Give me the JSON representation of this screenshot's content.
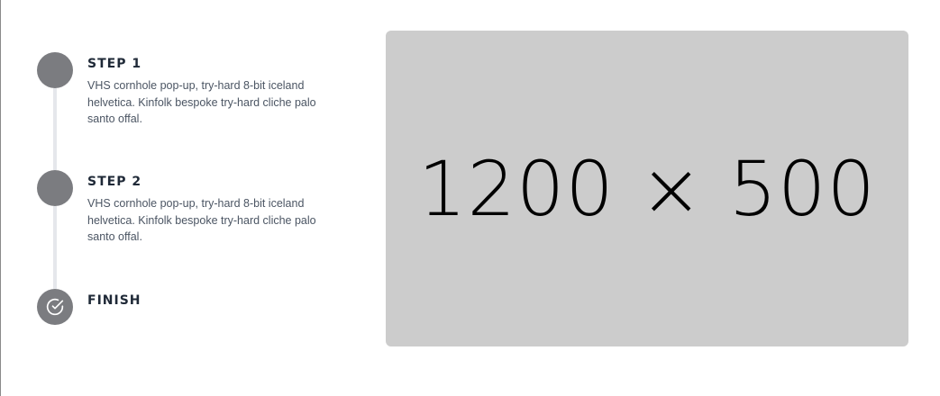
{
  "steps": [
    {
      "title": "STEP 1",
      "text": "VHS cornhole pop-up, try-hard 8-bit iceland helvetica. Kinfolk bespoke try-hard cliche palo santo offal."
    },
    {
      "title": "STEP 2",
      "text": "VHS cornhole pop-up, try-hard 8-bit iceland helvetica. Kinfolk bespoke try-hard cliche palo santo offal."
    }
  ],
  "finish": {
    "title": "FINISH",
    "icon": "check-circle-icon"
  },
  "image_placeholder": {
    "label": "1200 × 500"
  },
  "colors": {
    "step_circle": "#7b7c80",
    "connector": "#e5e7eb",
    "placeholder_bg": "#cccccc",
    "title_text": "#1f2937",
    "body_text": "#4b5563"
  }
}
